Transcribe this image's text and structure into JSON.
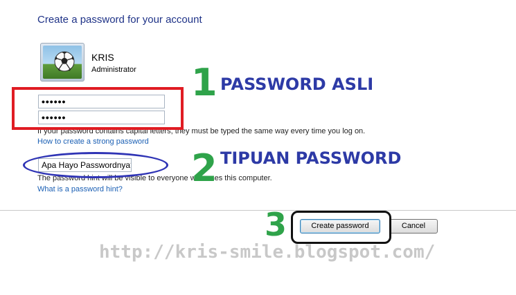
{
  "dialog": {
    "heading": "Create a password for your account",
    "user": {
      "name": "KRIS",
      "role": "Administrator",
      "avatar_icon": "soccer-ball-icon"
    },
    "password_field": "••••••",
    "confirm_field": "••••••",
    "caps_note": "If your password contains capital letters, they must be typed the same way every time you log on.",
    "strong_password_link": "How to create a strong password",
    "hint_value": "Apa Hayo Passwordnya?",
    "hint_note": "The password hint will be visible to everyone who uses this computer.",
    "hint_help_link": "What is a password hint?",
    "create_button": "Create password",
    "cancel_button": "Cancel"
  },
  "annotations": {
    "num1": "1",
    "label1": "PASSWORD ASLI",
    "num2": "2",
    "label2": "TIPUAN PASSWORD",
    "num3": "3",
    "watermark": "http://kris-smile.blogspot.com/",
    "colors": {
      "red_box": "#e01c23",
      "ellipse": "#2f34b5",
      "numbers": "#2fa34a",
      "labels": "#2d3aa6"
    }
  }
}
